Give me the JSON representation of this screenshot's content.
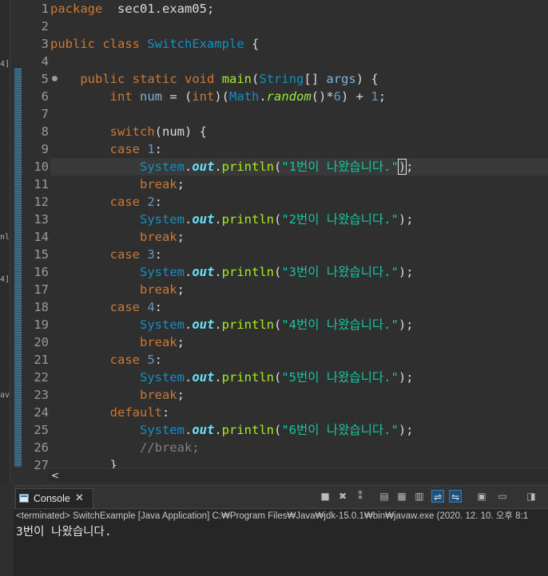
{
  "side_strip": {
    "fragments": [
      "4]",
      "nl",
      "4]",
      "av"
    ]
  },
  "editor": {
    "line_numbers": [
      "1",
      "2",
      "3",
      "4",
      "5",
      "6",
      "7",
      "8",
      "9",
      "10",
      "11",
      "12",
      "13",
      "14",
      "15",
      "16",
      "17",
      "18",
      "19",
      "20",
      "21",
      "22",
      "23",
      "24",
      "25",
      "26",
      "27"
    ],
    "current_line": 10,
    "lines": [
      [
        [
          "kw",
          "package"
        ],
        [
          "",
          "  sec01.exam05;"
        ]
      ],
      [],
      [
        [
          "kw",
          "public"
        ],
        [
          "",
          " "
        ],
        [
          "kw",
          "class"
        ],
        [
          "",
          " "
        ],
        [
          "cls",
          "SwitchExample"
        ],
        [
          "",
          " {"
        ]
      ],
      [],
      [
        [
          "",
          "    "
        ],
        [
          "kw",
          "public"
        ],
        [
          "",
          " "
        ],
        [
          "kw",
          "static"
        ],
        [
          "",
          " "
        ],
        [
          "kw",
          "void"
        ],
        [
          "",
          " "
        ],
        [
          "mth",
          "main"
        ],
        [
          "",
          "("
        ],
        [
          "cls",
          "String"
        ],
        [
          "",
          "[] "
        ],
        [
          "type",
          "args"
        ],
        [
          "",
          ") {"
        ]
      ],
      [
        [
          "",
          "        "
        ],
        [
          "kw",
          "int"
        ],
        [
          "",
          " "
        ],
        [
          "type",
          "num"
        ],
        [
          "",
          " = ("
        ],
        [
          "kw",
          "int"
        ],
        [
          "",
          ")("
        ],
        [
          "cls",
          "Math"
        ],
        [
          "",
          "."
        ],
        [
          "smth",
          "random"
        ],
        [
          "",
          "()*"
        ],
        [
          "num",
          "6"
        ],
        [
          "",
          ") + "
        ],
        [
          "num",
          "1"
        ],
        [
          "",
          ";"
        ]
      ],
      [],
      [
        [
          "",
          "        "
        ],
        [
          "kw",
          "switch"
        ],
        [
          "",
          "(num) {"
        ]
      ],
      [
        [
          "",
          "        "
        ],
        [
          "kw",
          "case"
        ],
        [
          "",
          " "
        ],
        [
          "num",
          "1"
        ],
        [
          "",
          ":"
        ]
      ],
      [
        [
          "",
          "            "
        ],
        [
          "cls",
          "System"
        ],
        [
          "",
          "."
        ],
        [
          "fld",
          "out"
        ],
        [
          "",
          "."
        ],
        [
          "mth",
          "println"
        ],
        [
          "",
          "("
        ],
        [
          "str",
          "\"1번이 나왔습니다.\""
        ],
        [
          "cur",
          ")"
        ],
        [
          "",
          ";"
        ]
      ],
      [
        [
          "",
          "            "
        ],
        [
          "kw",
          "break"
        ],
        [
          "",
          ";"
        ]
      ],
      [
        [
          "",
          "        "
        ],
        [
          "kw",
          "case"
        ],
        [
          "",
          " "
        ],
        [
          "num",
          "2"
        ],
        [
          "",
          ":"
        ]
      ],
      [
        [
          "",
          "            "
        ],
        [
          "cls",
          "System"
        ],
        [
          "",
          "."
        ],
        [
          "fld",
          "out"
        ],
        [
          "",
          "."
        ],
        [
          "mth",
          "println"
        ],
        [
          "",
          "("
        ],
        [
          "str",
          "\"2번이 나왔습니다.\""
        ],
        [
          "",
          ");"
        ]
      ],
      [
        [
          "",
          "            "
        ],
        [
          "kw",
          "break"
        ],
        [
          "",
          ";"
        ]
      ],
      [
        [
          "",
          "        "
        ],
        [
          "kw",
          "case"
        ],
        [
          "",
          " "
        ],
        [
          "num",
          "3"
        ],
        [
          "",
          ":"
        ]
      ],
      [
        [
          "",
          "            "
        ],
        [
          "cls",
          "System"
        ],
        [
          "",
          "."
        ],
        [
          "fld",
          "out"
        ],
        [
          "",
          "."
        ],
        [
          "mth",
          "println"
        ],
        [
          "",
          "("
        ],
        [
          "str",
          "\"3번이 나왔습니다.\""
        ],
        [
          "",
          ");"
        ]
      ],
      [
        [
          "",
          "            "
        ],
        [
          "kw",
          "break"
        ],
        [
          "",
          ";"
        ]
      ],
      [
        [
          "",
          "        "
        ],
        [
          "kw",
          "case"
        ],
        [
          "",
          " "
        ],
        [
          "num",
          "4"
        ],
        [
          "",
          ":"
        ]
      ],
      [
        [
          "",
          "            "
        ],
        [
          "cls",
          "System"
        ],
        [
          "",
          "."
        ],
        [
          "fld",
          "out"
        ],
        [
          "",
          "."
        ],
        [
          "mth",
          "println"
        ],
        [
          "",
          "("
        ],
        [
          "str",
          "\"4번이 나왔습니다.\""
        ],
        [
          "",
          ");"
        ]
      ],
      [
        [
          "",
          "            "
        ],
        [
          "kw",
          "break"
        ],
        [
          "",
          ";"
        ]
      ],
      [
        [
          "",
          "        "
        ],
        [
          "kw",
          "case"
        ],
        [
          "",
          " "
        ],
        [
          "num",
          "5"
        ],
        [
          "",
          ":"
        ]
      ],
      [
        [
          "",
          "            "
        ],
        [
          "cls",
          "System"
        ],
        [
          "",
          "."
        ],
        [
          "fld",
          "out"
        ],
        [
          "",
          "."
        ],
        [
          "mth",
          "println"
        ],
        [
          "",
          "("
        ],
        [
          "str",
          "\"5번이 나왔습니다.\""
        ],
        [
          "",
          ");"
        ]
      ],
      [
        [
          "",
          "            "
        ],
        [
          "kw",
          "break"
        ],
        [
          "",
          ";"
        ]
      ],
      [
        [
          "",
          "        "
        ],
        [
          "kw",
          "default"
        ],
        [
          "",
          ":"
        ]
      ],
      [
        [
          "",
          "            "
        ],
        [
          "cls",
          "System"
        ],
        [
          "",
          "."
        ],
        [
          "fld",
          "out"
        ],
        [
          "",
          "."
        ],
        [
          "mth",
          "println"
        ],
        [
          "",
          "("
        ],
        [
          "str",
          "\"6번이 나왔습니다.\""
        ],
        [
          "",
          ");"
        ]
      ],
      [
        [
          "",
          "            "
        ],
        [
          "cmt",
          "//break;"
        ]
      ],
      [
        [
          "",
          "        }"
        ]
      ]
    ]
  },
  "scrollbar": {
    "left_arrow": "<"
  },
  "console": {
    "tab_label": "Console",
    "tab_close": "✕",
    "status": "<terminated> SwitchExample [Java Application] C:₩Program Files₩Java₩jdk-15.0.1₩bin₩javaw.exe  (2020. 12. 10. 오후 8:1",
    "output": "3번이 나왔습니다.",
    "toolbar_icons": [
      "terminate-icon",
      "remove-launch-icon",
      "remove-all-icon",
      "scroll-lock-icon",
      "word-wrap-icon",
      "pin-console-icon",
      "show-on-stdout-icon",
      "show-on-stderr-icon",
      "open-console-icon",
      "display-console-icon",
      "new-console-icon"
    ]
  },
  "colors": {
    "background": "#2f2f2f",
    "keyword": "#cc7832",
    "string": "#17c6a3",
    "class": "#1290c3",
    "method": "#a7ec21"
  }
}
